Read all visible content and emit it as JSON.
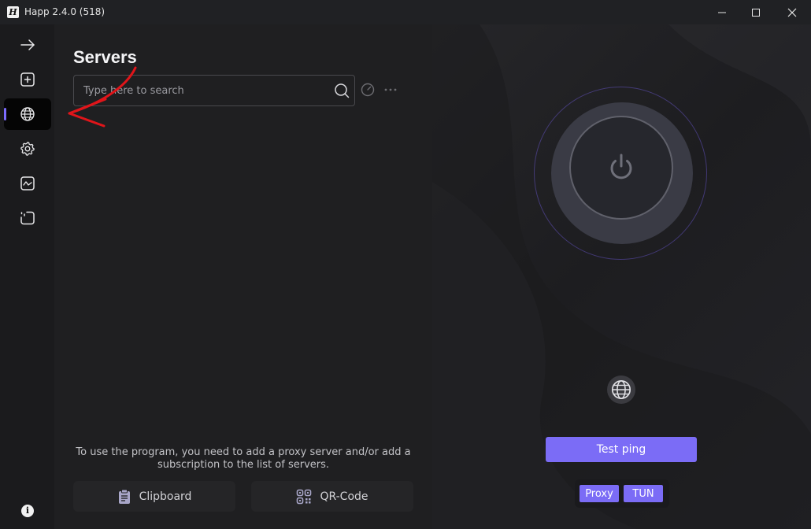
{
  "window": {
    "title": "Happ 2.4.0 (518)",
    "app_icon_letter": "H",
    "controls": [
      "minimize",
      "maximize",
      "close"
    ]
  },
  "sidebar": {
    "items": [
      {
        "icon": "arrow-right-icon",
        "active": false
      },
      {
        "icon": "add-square-icon",
        "active": false
      },
      {
        "icon": "globe-icon",
        "active": true
      },
      {
        "icon": "gear-icon",
        "active": false
      },
      {
        "icon": "activity-chart-icon",
        "active": false
      },
      {
        "icon": "log-icon",
        "active": false
      }
    ],
    "info_label": "i"
  },
  "servers": {
    "title": "Servers",
    "search_placeholder": "Type here to search",
    "empty_hint": "To use the program, you need to add a proxy server and/or add a subscription to the list of servers.",
    "clipboard_label": "Clipboard",
    "qrcode_label": "QR-Code"
  },
  "connection": {
    "test_ping_label": "Test ping",
    "modes": [
      {
        "label": "Proxy"
      },
      {
        "label": "TUN"
      }
    ]
  },
  "colors": {
    "accent": "#7b6cf6",
    "annotation_arrow": "#e0151a"
  }
}
